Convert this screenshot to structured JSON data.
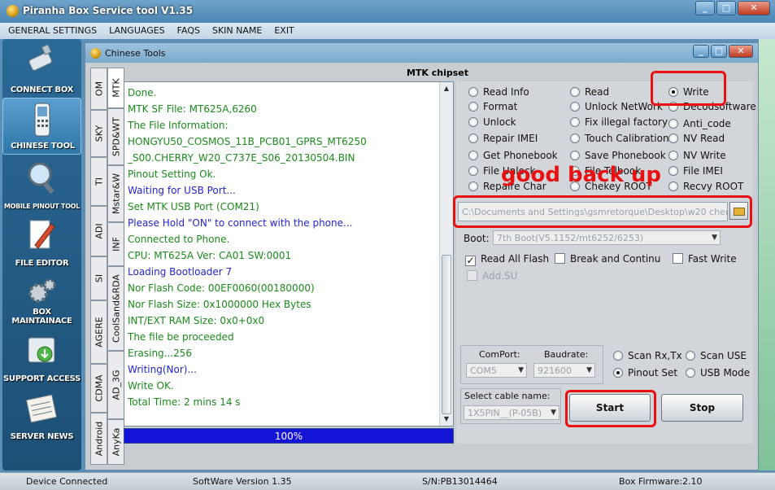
{
  "window": {
    "title": "Piranha Box Service tool V1.35",
    "controls": [
      "_",
      "□",
      "✕"
    ]
  },
  "menu": [
    "GENERAL SETTINGS",
    "LANGUAGES",
    "FAQS",
    "SKIN NAME",
    "EXIT"
  ],
  "sidebar": [
    {
      "label": "CONNECT BOX",
      "icon": "usb-stick-icon"
    },
    {
      "label": "CHINESE TOOL",
      "icon": "mobile-phone-icon"
    },
    {
      "label": "MOBILE PINOUT TOOL",
      "icon": "magnifier-icon"
    },
    {
      "label": "FILE EDITOR",
      "icon": "document-pen-icon"
    },
    {
      "label": "BOX MAINTAINACE",
      "icon": "gears-icon"
    },
    {
      "label": "SUPPORT ACCESS",
      "icon": "support-box-icon"
    },
    {
      "label": "SERVER NEWS",
      "icon": "newspaper-icon"
    }
  ],
  "child_window": {
    "title": "Chinese Tools",
    "controls": [
      "_",
      "□",
      "✕"
    ]
  },
  "tabs_outer": [
    "OM",
    "SKY",
    "TI",
    "ADI",
    "SI",
    "AGERE",
    "CDMA",
    "Android"
  ],
  "tabs_inner": [
    "MTK",
    "SPD&WT",
    "Mstar&W",
    "INF",
    "CoolSand&RDA",
    "AD_3G",
    "AnyKa"
  ],
  "chipset_title": "MTK chipset",
  "log": [
    {
      "text": "Done.",
      "color": "#1a8a1a"
    },
    {
      "text": "MTK SF File: MT625A,6260",
      "color": "#1a8a1a"
    },
    {
      "text": "The File Information:",
      "color": "#1a8a1a"
    },
    {
      "text": "HONGYU50_COSMOS_11B_PCB01_GPRS_MT6250",
      "color": "#1a8a1a"
    },
    {
      "text": "_S00.CHERRY_W20_C737E_S06_20130504.BIN",
      "color": "#1a8a1a"
    },
    {
      "text": "Pinout Setting Ok.",
      "color": "#1a8a1a"
    },
    {
      "text": "Waiting for USB Port...",
      "color": "#2323d0"
    },
    {
      "text": "Set MTK USB Port (COM21)",
      "color": "#1a8a1a"
    },
    {
      "text": "Please Hold \"ON\" to connect with the phone...",
      "color": "#2323d0"
    },
    {
      "text": "Connected to Phone.",
      "color": "#1a8a1a"
    },
    {
      "text": "CPU: MT625A Ver: CA01  SW:0001",
      "color": "#1a8a1a"
    },
    {
      "text": "Loading Bootloader 7",
      "color": "#2323d0"
    },
    {
      "text": "Nor Flash Code: 00EF0060(00180000)",
      "color": "#1a8a1a"
    },
    {
      "text": "Nor Flash Size: 0x1000000 Hex Bytes",
      "color": "#1a8a1a"
    },
    {
      "text": "INT/EXT RAM  Size: 0x0+0x0",
      "color": "#1a8a1a"
    },
    {
      "text": "The file be proceeded",
      "color": "#1a8a1a"
    },
    {
      "text": "Erasing...256",
      "color": "#1a8a1a"
    },
    {
      "text": "Writing(Nor)...",
      "color": "#2323d0"
    },
    {
      "text": "Write OK.",
      "color": "#1a8a1a"
    },
    {
      "text": "Total Time: 2 mins 14 s",
      "color": "#1a8a1a"
    }
  ],
  "progress": {
    "value": 1.0,
    "label": "100%"
  },
  "operations": {
    "col1": [
      "Read Info",
      "Format",
      "Unlock",
      "Repair IMEI",
      "Get Phonebook",
      "File Unlock",
      "Repaire Char"
    ],
    "col2": [
      "Read",
      "Unlock NetWork",
      "Fix illegal factory",
      "Touch Calibration",
      "Save Phonebook",
      "File Telbook",
      "Chekey ROOT"
    ],
    "col3": [
      "Write",
      "Decodsoftware",
      "Anti_code",
      "NV  Read",
      "NV  Write",
      "File IMEI",
      "Recvy ROOT"
    ],
    "selected": "Write"
  },
  "annotation": {
    "text": "good back up",
    "color": "#e81010"
  },
  "file_path": "C:\\Documents and Settings\\gsmretorque\\Desktop\\w20 cherr",
  "boot": {
    "label": "Boot:",
    "value": "7th Boot(V5.1152/mt6252/6253)"
  },
  "checks": {
    "read_all_flash": {
      "label": "Read All Flash",
      "checked": true
    },
    "break_continue": {
      "label": "Break and Continu",
      "checked": false
    },
    "fast_write": {
      "label": "Fast Write",
      "checked": false
    },
    "add_su": {
      "label": "Add.SU",
      "checked": false
    }
  },
  "port": {
    "comport_label": "ComPort:",
    "comport_value": "COM5",
    "baudrate_label": "Baudrate:",
    "baudrate_value": "921600",
    "scan_rx_tx": "Scan Rx,Tx",
    "scan_use": "Scan USE",
    "pinout_set": "Pinout Set",
    "usb_mode": "USB Mode",
    "selected": "Pinout Set"
  },
  "cable": {
    "label": "Select cable name:",
    "value": "1X5PIN__(P-05B)"
  },
  "buttons": {
    "start": "Start",
    "stop": "Stop"
  },
  "status": {
    "device": "Device Connected",
    "software": "SoftWare Version 1.35",
    "serial": "S/N:PB13014464",
    "firmware": "Box Firmware:2.10"
  }
}
